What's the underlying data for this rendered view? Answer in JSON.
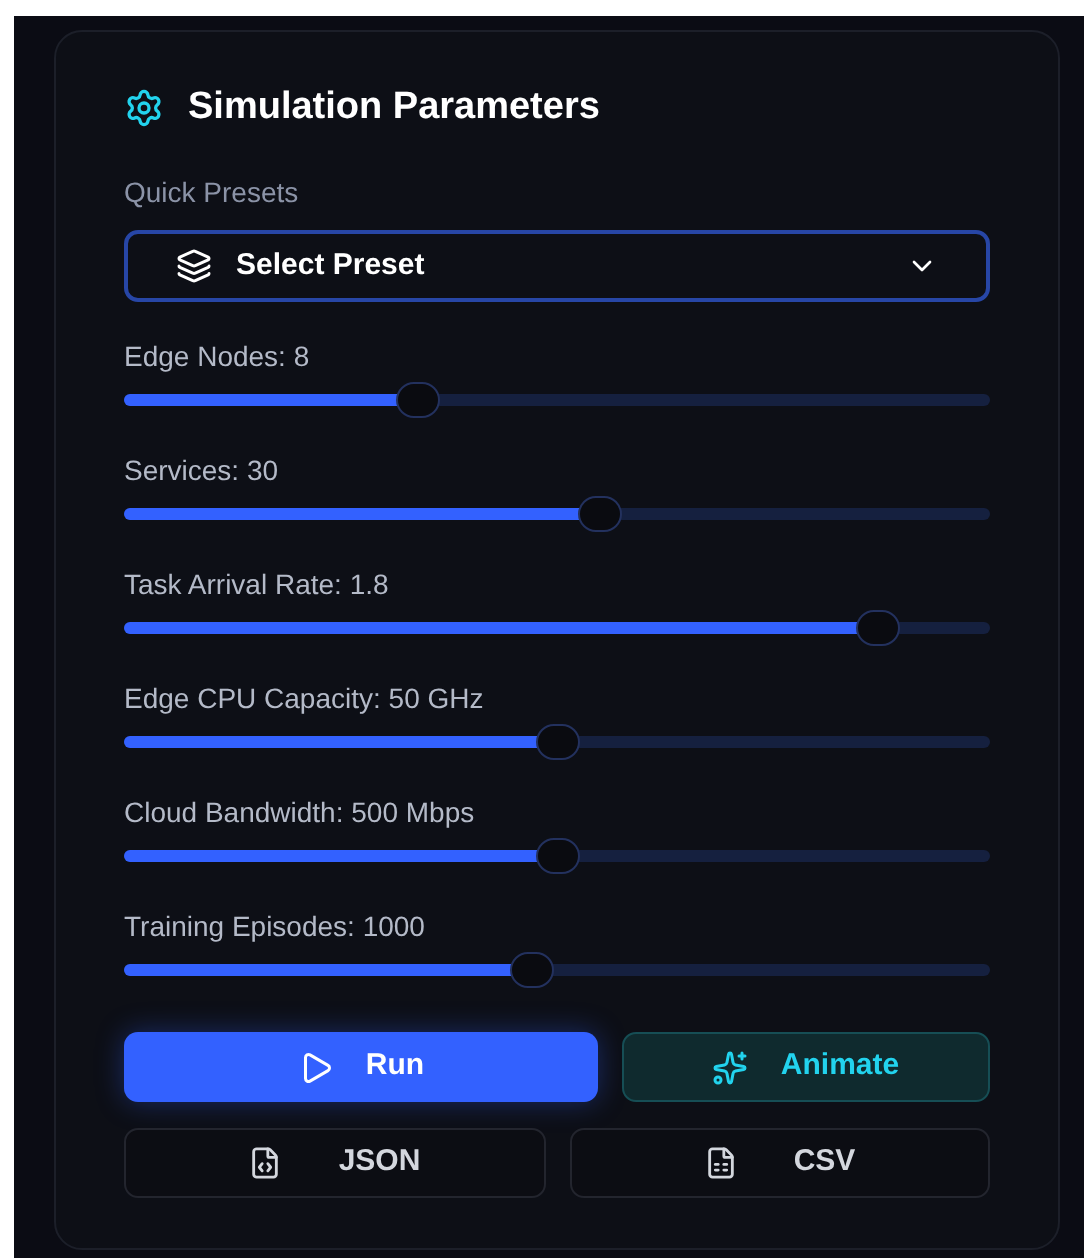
{
  "panel": {
    "title": "Simulation Parameters"
  },
  "presets": {
    "label": "Quick Presets",
    "placeholder": "Select Preset"
  },
  "sliders": [
    {
      "label": "Edge Nodes: 8",
      "level": 0.34
    },
    {
      "label": "Services: 30",
      "level": 0.55
    },
    {
      "label": "Task Arrival Rate: 1.8",
      "level": 0.87
    },
    {
      "label": "Edge CPU Capacity: 50 GHz",
      "level": 0.5
    },
    {
      "label": "Cloud Bandwidth: 500 Mbps",
      "level": 0.5
    },
    {
      "label": "Training Episodes: 1000",
      "level": 0.47
    }
  ],
  "actions": [
    {
      "label": "Run",
      "kind": "primary"
    },
    {
      "label": "Animate",
      "kind": "accent"
    }
  ],
  "exports": [
    {
      "label": "JSON",
      "kind": "code"
    },
    {
      "label": "CSV",
      "kind": "sheet"
    }
  ]
}
